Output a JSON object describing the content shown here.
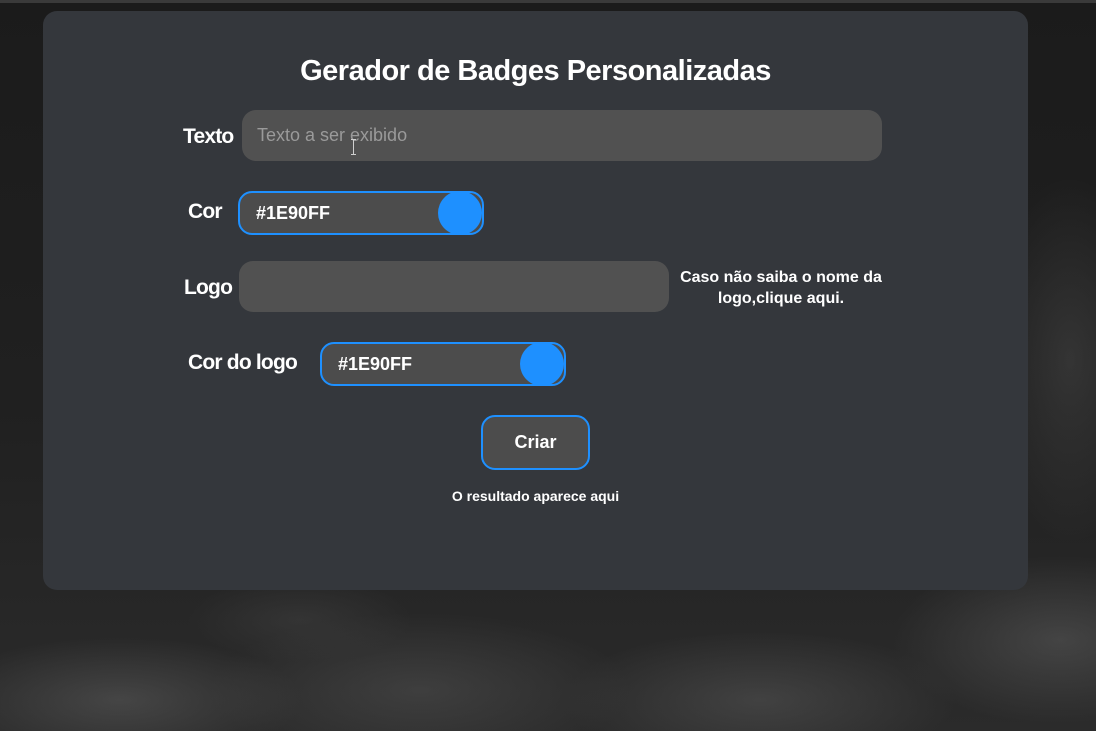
{
  "title": "Gerador de Badges Personalizadas",
  "fields": {
    "text": {
      "label": "Texto",
      "value": "",
      "placeholder": "Texto a ser exibido"
    },
    "color": {
      "label": "Cor",
      "value": "#1E90FF"
    },
    "logo": {
      "label": "Logo",
      "value": "",
      "hint": "Caso não saiba o nome da logo,clique aqui."
    },
    "logo_color": {
      "label": "Cor do logo",
      "value": "#1E90FF"
    }
  },
  "create_button": "Criar",
  "result_text": "O resultado aparece aqui",
  "colors": {
    "accent": "#1E90FF",
    "panel": "#34373C",
    "input": "#515151"
  },
  "icons": {
    "text_cursor": "i-beam-cursor-icon"
  }
}
